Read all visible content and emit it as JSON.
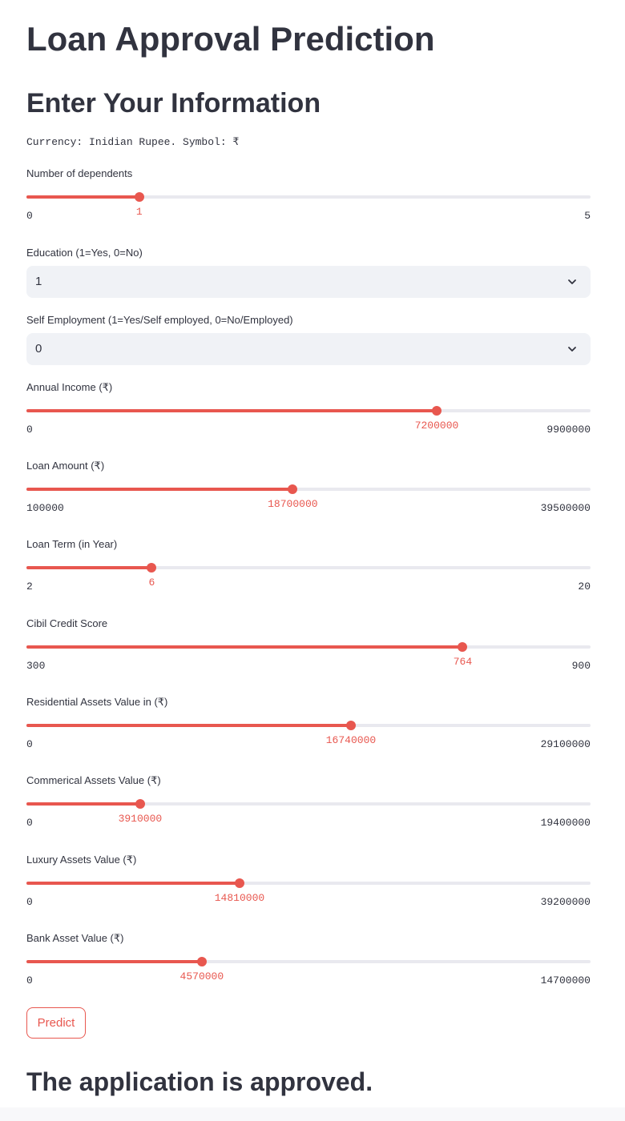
{
  "page": {
    "title": "Loan Approval Prediction",
    "subtitle": "Enter Your Information",
    "currency_note": "Currency: Inidian Rupee. Symbol: ₹"
  },
  "colors": {
    "accent": "#e8574f",
    "track": "#e9e9ef",
    "text": "#31333f",
    "select_bg": "#f0f2f6"
  },
  "fields": {
    "dependents": {
      "label": "Number of dependents",
      "value": 1,
      "min": 0,
      "max": 5
    },
    "education": {
      "label": "Education (1=Yes, 0=No)",
      "value": "1",
      "icon": "chevron-down-icon"
    },
    "self_employment": {
      "label": "Self Employment (1=Yes/Self employed, 0=No/Employed)",
      "value": "0",
      "icon": "chevron-down-icon"
    },
    "annual_income": {
      "label": "Annual Income (₹)",
      "value": 7200000,
      "min": 0,
      "max": 9900000
    },
    "loan_amount": {
      "label": "Loan Amount (₹)",
      "value": 18700000,
      "min": 100000,
      "max": 39500000
    },
    "loan_term": {
      "label": "Loan Term (in Year)",
      "value": 6,
      "min": 2,
      "max": 20
    },
    "cibil_score": {
      "label": "Cibil Credit Score",
      "value": 764,
      "min": 300,
      "max": 900
    },
    "residential_assets": {
      "label": "Residential Assets Value in (₹)",
      "value": 16740000,
      "min": 0,
      "max": 29100000
    },
    "commercial_assets": {
      "label": "Commerical Assets Value (₹)",
      "value": 3910000,
      "min": 0,
      "max": 19400000
    },
    "luxury_assets": {
      "label": "Luxury Assets Value (₹)",
      "value": 14810000,
      "min": 0,
      "max": 39200000
    },
    "bank_assets": {
      "label": "Bank Asset Value (₹)",
      "value": 4570000,
      "min": 0,
      "max": 14700000
    }
  },
  "predict_button": {
    "label": "Predict"
  },
  "result": {
    "text": "The application is approved."
  }
}
